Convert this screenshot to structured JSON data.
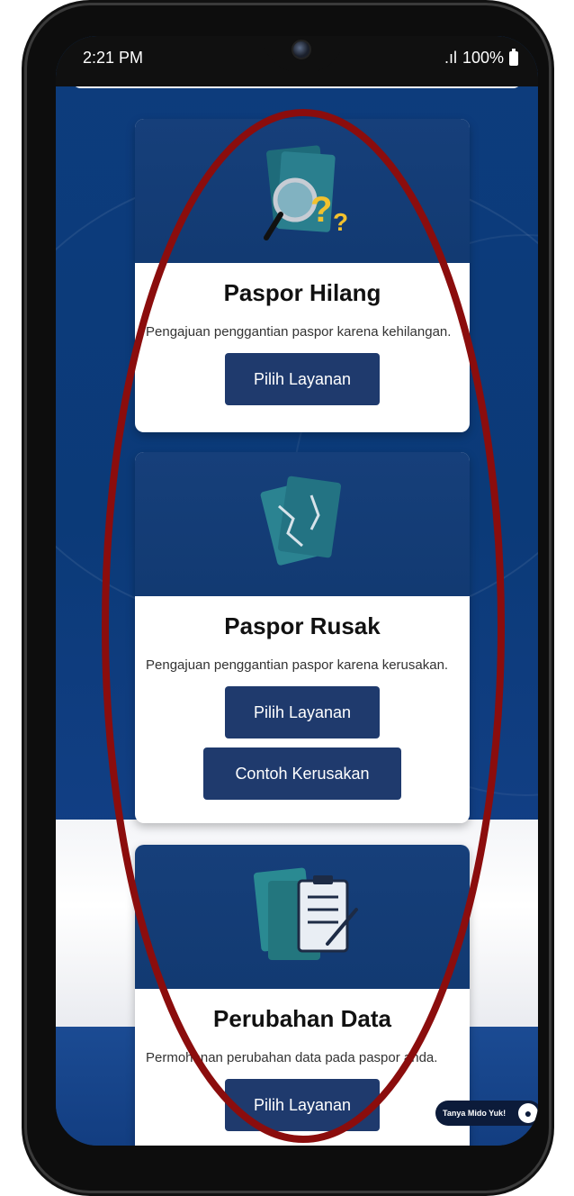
{
  "status_bar": {
    "time": "2:21 PM",
    "signal": ".ıl",
    "battery": "100%"
  },
  "cards": [
    {
      "title": "Paspor Hilang",
      "description": "Pengajuan penggantian paspor karena kehilangan.",
      "primary_button": "Pilih Layanan"
    },
    {
      "title": "Paspor Rusak",
      "description": "Pengajuan penggantian paspor karena kerusakan.",
      "primary_button": "Pilih Layanan",
      "secondary_button": "Contoh Kerusakan"
    },
    {
      "title": "Perubahan Data",
      "description": "Permohonan perubahan data pada paspor anda.",
      "primary_button": "Pilih Layanan"
    }
  ],
  "chat": {
    "label": "Tanya Mido Yuk!"
  },
  "colors": {
    "primary_button": "#1f3a6d",
    "hero_bg": "#123a72",
    "highlight_oval": "#8b0d0d"
  }
}
